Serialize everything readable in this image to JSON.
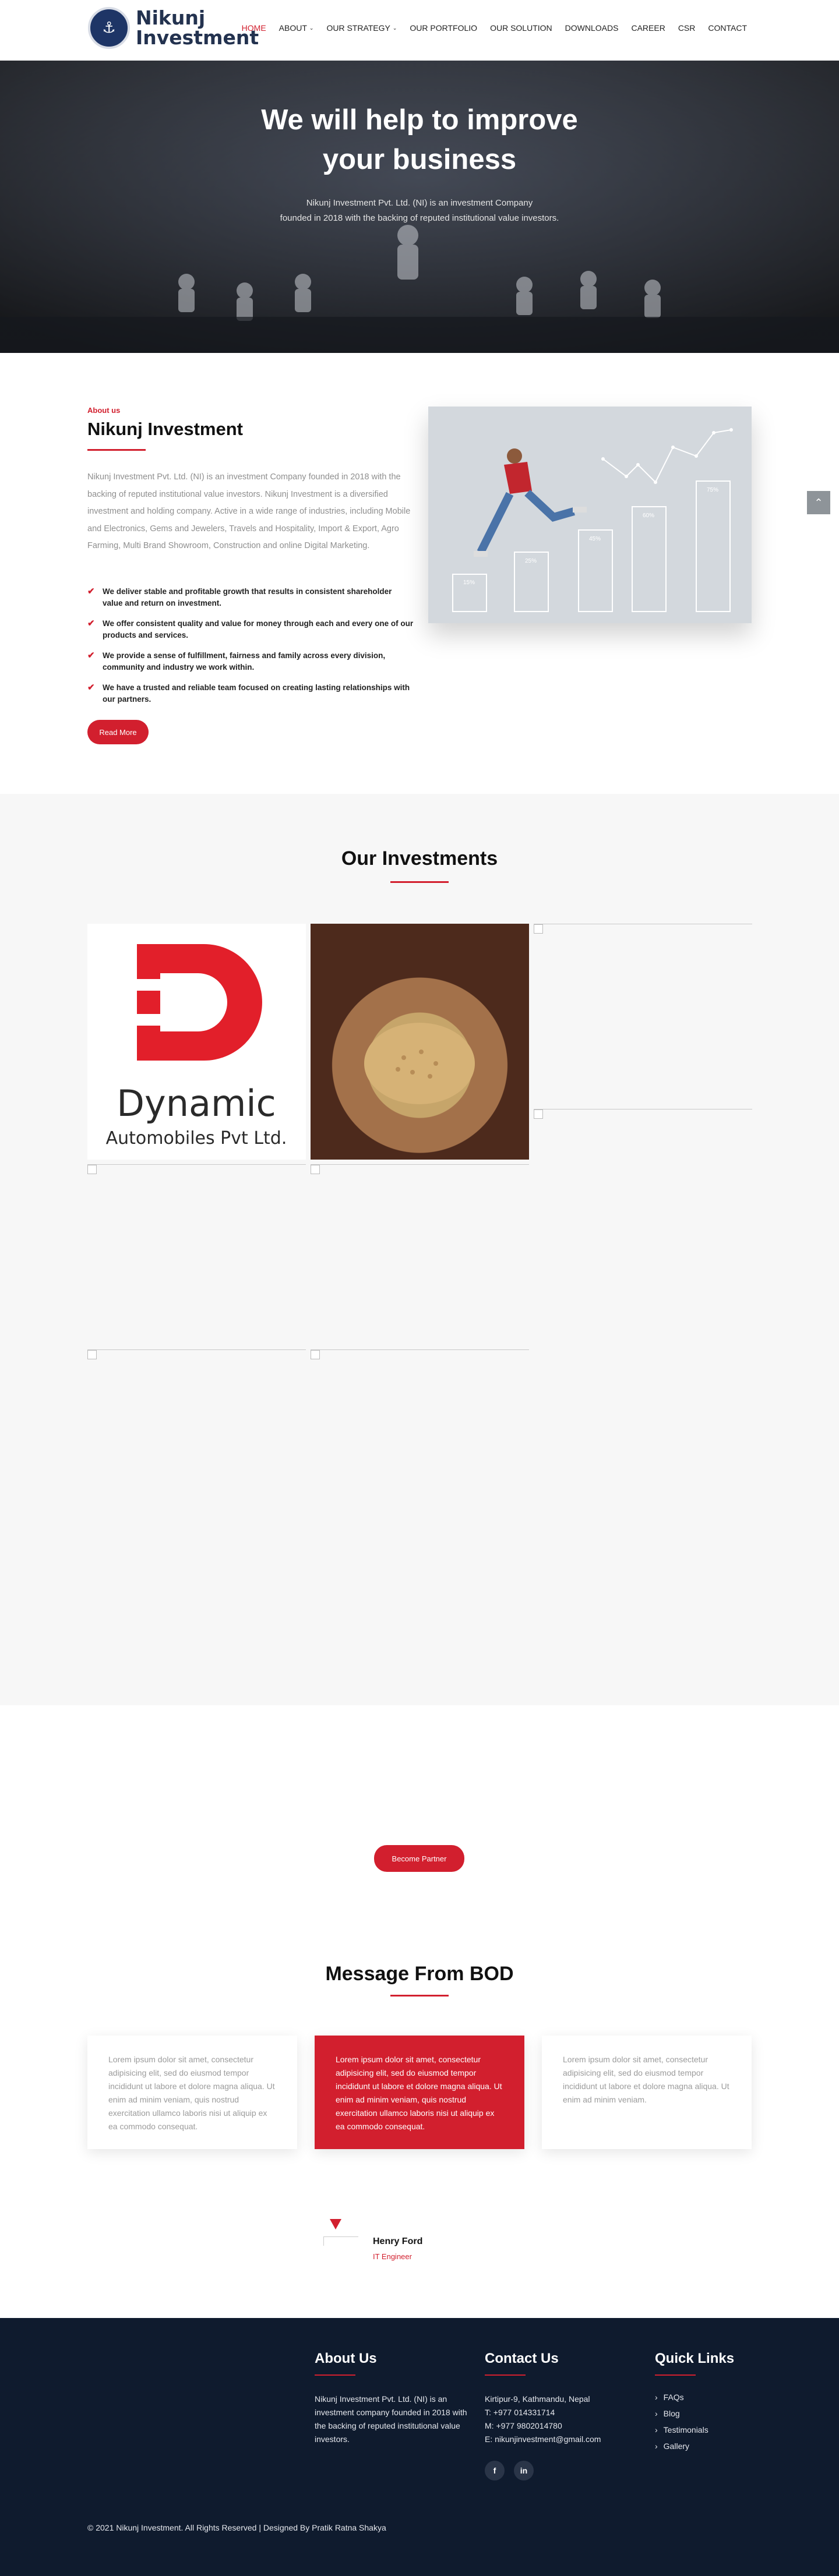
{
  "header": {
    "logo_line1": "Nikunj",
    "logo_line2": "Investment",
    "nav": [
      {
        "label": "HOME",
        "caret": ""
      },
      {
        "label": "ABOUT",
        "caret": "⌄"
      },
      {
        "label": "OUR STRATEGY",
        "caret": "⌄"
      },
      {
        "label": "OUR PORTFOLIO",
        "caret": ""
      },
      {
        "label": "OUR SOLUTION",
        "caret": ""
      },
      {
        "label": "DOWNLOADS",
        "caret": ""
      },
      {
        "label": "CAREER",
        "caret": ""
      },
      {
        "label": "CSR",
        "caret": ""
      },
      {
        "label": "CONTACT",
        "caret": ""
      }
    ]
  },
  "hero": {
    "title_line1": "We will help to improve",
    "title_line2": "your business",
    "sub_line1": "Nikunj Investment Pvt. Ltd. (NI) is an investment Company",
    "sub_line2": "founded in 2018 with the backing of reputed institutional value investors."
  },
  "about": {
    "kicker": "About us",
    "title": "Nikunj Investment",
    "text": "Nikunj Investment Pvt. Ltd. (NI) is an investment Company founded in 2018 with the backing of reputed institutional value investors. Nikunj Investment is a diversified investment and holding company. Active in a wide range of industries, including Mobile and Electronics, Gems and Jewelers, Travels and Hospitality, Import & Export, Agro Farming, Multi Brand Showroom, Construction and online Digital Marketing.",
    "points": [
      "We deliver stable and profitable growth that results in consistent shareholder value and return on investment.",
      "We offer consistent quality and value for money through each and every one of our products and services.",
      "We provide a sense of fulfillment, fairness and family across every division, community and industry we work within.",
      "We have a trusted and reliable team focused on creating lasting relationships with our partners."
    ],
    "button": "Read More",
    "chart_bar_labels": [
      "15%",
      "25%",
      "45%",
      "60%",
      "75%"
    ]
  },
  "investments": {
    "title": "Our Investments",
    "dynamic_name": "Dynamic",
    "dynamic_sub": "Automobiles Pvt Ltd."
  },
  "partner": {
    "button": "Become Partner"
  },
  "bod": {
    "title": "Message From BOD",
    "cards": [
      "Lorem ipsum dolor sit amet, consectetur adipisicing elit, sed do eiusmod tempor incididunt ut labore et dolore magna aliqua. Ut enim ad minim veniam, quis nostrud exercitation ullamco laboris nisi ut aliquip ex ea commodo consequat.",
      "Lorem ipsum dolor sit amet, consectetur adipisicing elit, sed do eiusmod tempor incididunt ut labore et dolore magna aliqua. Ut enim ad minim veniam, quis nostrud exercitation ullamco laboris nisi ut aliquip ex ea commodo consequat.",
      "Lorem ipsum dolor sit amet, consectetur adipisicing elit, sed do eiusmod tempor incididunt ut labore et dolore magna aliqua. Ut enim ad minim veniam."
    ],
    "name": "Henry Ford",
    "role": "IT Engineer"
  },
  "footer": {
    "about_title": "About Us",
    "about_text": "Nikunj Investment Pvt. Ltd. (NI) is an investment company founded in 2018 with the backing of reputed institutional value investors.",
    "contact_title": "Contact Us",
    "contact_lines": [
      "Kirtipur-9, Kathmandu, Nepal",
      "T: +977 014331714",
      "M: +977 9802014780",
      "E: nikunjinvestment@gmail.com"
    ],
    "links_title": "Quick Links",
    "links": [
      "FAQs",
      "Blog",
      "Testimonials",
      "Gallery"
    ],
    "social": [
      "f",
      "in"
    ],
    "copyright": "© 2021 Nikunj Investment. All Rights Reserved | Designed By Pratik Ratna Shakya"
  },
  "colors": {
    "accent": "#d21f2e",
    "footer_bg": "#0f1b2e",
    "logo_navy": "#23324f"
  }
}
